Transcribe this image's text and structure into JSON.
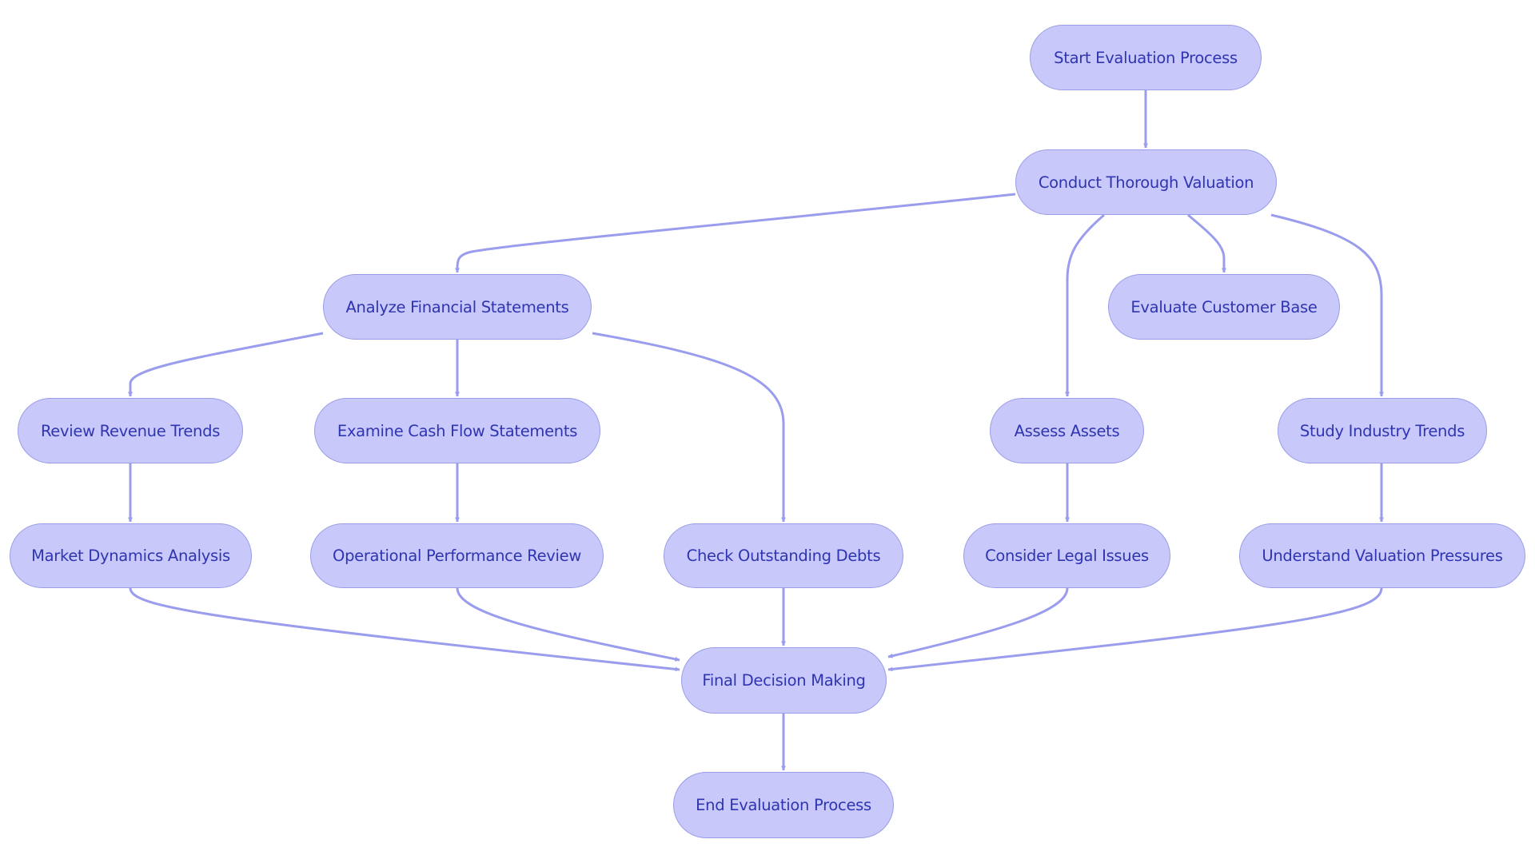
{
  "diagram": {
    "type": "flowchart",
    "colors": {
      "node_fill": "#c8c9fa",
      "node_stroke": "#9a9de6",
      "text": "#2f35b0",
      "edge": "#9a9ded"
    },
    "nodes": [
      {
        "id": "start",
        "label": "Start Evaluation Process"
      },
      {
        "id": "conduct",
        "label": "Conduct Thorough Valuation"
      },
      {
        "id": "analyze",
        "label": "Analyze Financial Statements"
      },
      {
        "id": "customer",
        "label": "Evaluate Customer Base"
      },
      {
        "id": "revenue",
        "label": "Review Revenue Trends"
      },
      {
        "id": "cashflow",
        "label": "Examine Cash Flow Statements"
      },
      {
        "id": "assets",
        "label": "Assess Assets"
      },
      {
        "id": "industry",
        "label": "Study Industry Trends"
      },
      {
        "id": "market",
        "label": "Market Dynamics Analysis"
      },
      {
        "id": "operational",
        "label": "Operational Performance Review"
      },
      {
        "id": "debts",
        "label": "Check Outstanding Debts"
      },
      {
        "id": "legal",
        "label": "Consider Legal Issues"
      },
      {
        "id": "pressures",
        "label": "Understand Valuation Pressures"
      },
      {
        "id": "final",
        "label": "Final Decision Making"
      },
      {
        "id": "end",
        "label": "End Evaluation Process"
      }
    ],
    "edges": [
      {
        "from": "start",
        "to": "conduct"
      },
      {
        "from": "conduct",
        "to": "analyze"
      },
      {
        "from": "conduct",
        "to": "assets"
      },
      {
        "from": "conduct",
        "to": "customer"
      },
      {
        "from": "conduct",
        "to": "industry"
      },
      {
        "from": "analyze",
        "to": "revenue"
      },
      {
        "from": "analyze",
        "to": "cashflow"
      },
      {
        "from": "analyze",
        "to": "debts"
      },
      {
        "from": "revenue",
        "to": "market"
      },
      {
        "from": "cashflow",
        "to": "operational"
      },
      {
        "from": "assets",
        "to": "legal"
      },
      {
        "from": "industry",
        "to": "pressures"
      },
      {
        "from": "market",
        "to": "final"
      },
      {
        "from": "operational",
        "to": "final"
      },
      {
        "from": "debts",
        "to": "final"
      },
      {
        "from": "legal",
        "to": "final"
      },
      {
        "from": "pressures",
        "to": "final"
      },
      {
        "from": "final",
        "to": "end"
      }
    ]
  }
}
